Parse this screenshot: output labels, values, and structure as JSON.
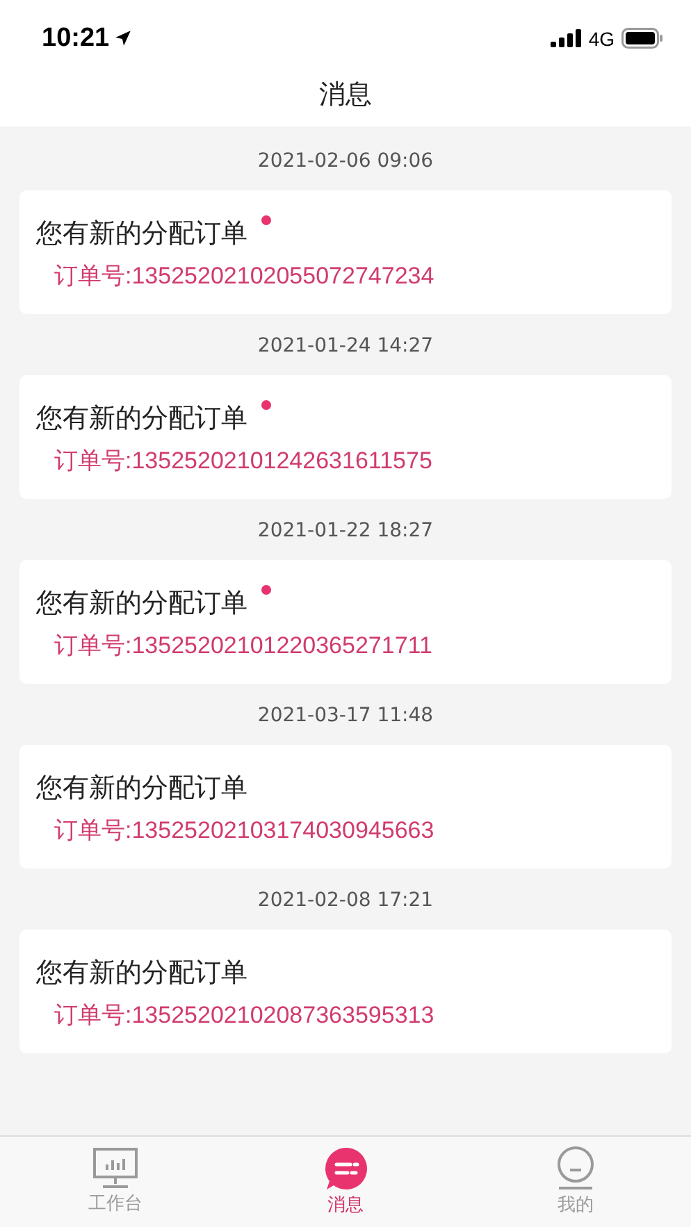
{
  "status_bar": {
    "time": "10:21",
    "network": "4G"
  },
  "header": {
    "title": "消息"
  },
  "messages": [
    {
      "time": "2021-02-06 09:06",
      "title": "您有新的分配订单",
      "order": "订单号:13525202102055072747234",
      "unread": true
    },
    {
      "time": "2021-01-24 14:27",
      "title": "您有新的分配订单",
      "order": "订单号:13525202101242631611575",
      "unread": true
    },
    {
      "time": "2021-01-22 18:27",
      "title": "您有新的分配订单",
      "order": "订单号:13525202101220365271711",
      "unread": true
    },
    {
      "time": "2021-03-17 11:48",
      "title": "您有新的分配订单",
      "order": "订单号:13525202103174030945663",
      "unread": false
    },
    {
      "time": "2021-02-08 17:21",
      "title": "您有新的分配订单",
      "order": "订单号:13525202102087363595313",
      "unread": false
    }
  ],
  "tab_bar": [
    {
      "label": "工作台",
      "kind": "monitor",
      "selected": false
    },
    {
      "label": "消息",
      "kind": "chat",
      "selected": true
    },
    {
      "label": "我的",
      "kind": "face",
      "selected": false
    }
  ]
}
